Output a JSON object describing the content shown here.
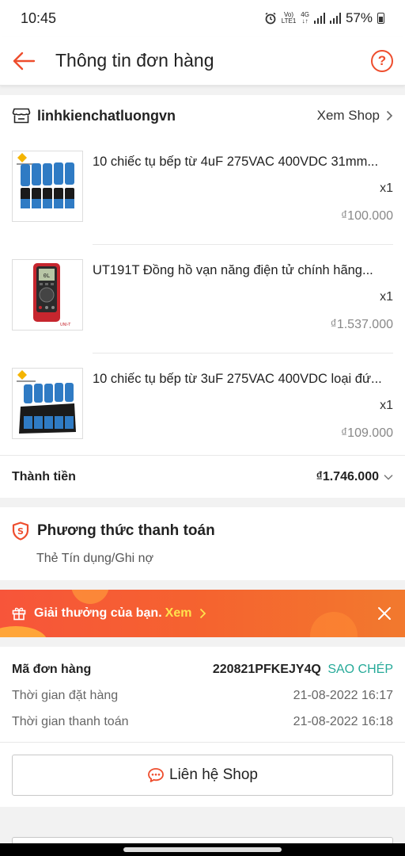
{
  "status_bar": {
    "time": "10:45",
    "network_top": "Vo)",
    "network_bottom": "LTE1",
    "net_type": "4G",
    "battery": "57%"
  },
  "header": {
    "title": "Thông tin đơn hàng",
    "help_label": "?"
  },
  "shop": {
    "name": "linhkienchatluongvn",
    "view_label": "Xem Shop"
  },
  "products": [
    {
      "name": "10 chiếc tụ bếp từ 4uF 275VAC 400VDC 31mm...",
      "qty": "x1",
      "price": "₫100.000"
    },
    {
      "name": "UT191T Đồng hồ vạn năng điện tử chính hãng...",
      "qty": "x1",
      "price": "₫1.537.000"
    },
    {
      "name": "10 chiếc tụ bếp từ 3uF 275VAC 400VDC loại đứ...",
      "qty": "x1",
      "price": "₫109.000"
    }
  ],
  "total": {
    "label": "Thành tiền",
    "value": "₫1.746.000"
  },
  "payment": {
    "title": "Phương thức thanh toán",
    "method": "Thẻ Tín dụng/Ghi nợ"
  },
  "reward": {
    "text": "Giải thưởng của bạn.",
    "link": "Xem"
  },
  "order": {
    "id_label": "Mã đơn hàng",
    "id": "220821PFKEJY4Q",
    "copy_label": "SAO CHÉP",
    "order_time_label": "Thời gian đặt hàng",
    "order_time": "21-08-2022 16:17",
    "payment_time_label": "Thời gian thanh toán",
    "payment_time": "21-08-2022 16:18",
    "contact_label": "Liên hệ Shop"
  },
  "colors": {
    "brand": "#ee4d2d",
    "copy": "#26aa99",
    "reward_link": "#ffe34d"
  }
}
